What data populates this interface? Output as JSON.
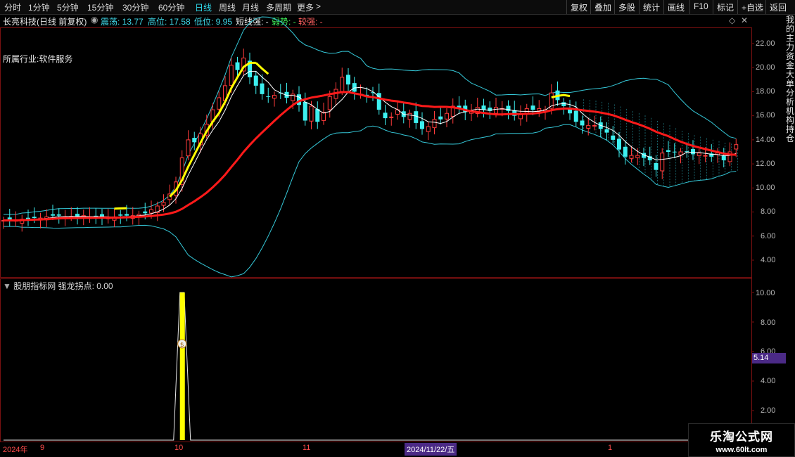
{
  "toolbar": {
    "periods": [
      "分时",
      "1分钟",
      "5分钟",
      "15分钟",
      "30分钟",
      "60分钟",
      "日线",
      "周线",
      "月线",
      "多周期",
      "更多"
    ],
    "active_period": "日线",
    "more_icon": "chevron-right-icon",
    "right_buttons": [
      "复权",
      "叠加",
      "多股",
      "统计",
      "画线",
      "F10",
      "标记",
      "+自选",
      "返回"
    ]
  },
  "infobar": {
    "stock": "长亮科技(日线 前复权)",
    "zhendang": "震荡: 13.77",
    "gaowei": "高位: 17.58",
    "diwei": "低位: 9.95",
    "duanxian": "短线强: -",
    "ruoshi": "弱势: -",
    "jiaoqiang": "较强: -"
  },
  "industry": "所属行业:软件服务",
  "main_axis": [
    "22.00",
    "20.00",
    "18.00",
    "16.00",
    "14.00",
    "12.00",
    "10.00",
    "8.00",
    "6.00",
    "4.00"
  ],
  "sub_panel": {
    "title": "股朋指标网 强龙拐点: 0.00",
    "axis": [
      "10.00",
      "8.00",
      "6.00",
      "4.00",
      "2.00"
    ],
    "price_tag": "5.14",
    "marker_glyph": "$"
  },
  "dates": {
    "labels": [
      "2024年",
      "9",
      "10",
      "11",
      "1"
    ],
    "highlight": "2024/11/22/五"
  },
  "right_strip_text": "我的主力资金大单分析机构持仓",
  "watermark": {
    "title": "乐淘公式网",
    "url": "www.60lt.com"
  },
  "colors": {
    "up": "#ff3b3b",
    "down": "#3df0f0",
    "yellow": "#ffff00",
    "red_line": "#ff1a1a",
    "band": "#35c8d8",
    "highlight": "#4b2a86"
  },
  "chart_data": {
    "type": "candlestick",
    "ylim": [
      3.0,
      23.5
    ],
    "closes": [
      7.3,
      7.3,
      7.3,
      7.4,
      7.4,
      7.5,
      7.5,
      7.6,
      7.7,
      7.7,
      7.6,
      7.6,
      7.6,
      7.7,
      7.6,
      7.6,
      7.6,
      7.5,
      7.6,
      7.7,
      7.7,
      7.7,
      7.8,
      7.9,
      8.2,
      8.5,
      8.8,
      9.5,
      10.5,
      12.5,
      14.0,
      13.8,
      14.5,
      15.3,
      16.5,
      17.5,
      18.5,
      20.2,
      19.8,
      20.8,
      19.2,
      18.5,
      17.8,
      17.6,
      17.7,
      17.9,
      17.5,
      17.8,
      16.9,
      15.6,
      16.8,
      15.5,
      16.3,
      17.6,
      18.2,
      19.2,
      18.6,
      18.0,
      17.8,
      17.7,
      17.9,
      16.5,
      15.8,
      15.9,
      16.5,
      15.9,
      16.2,
      15.4,
      14.9,
      15.1,
      15.7,
      15.7,
      16.2,
      16.8,
      16.6,
      16.3,
      16.4,
      16.7,
      16.5,
      16.4,
      16.7,
      16.6,
      16.4,
      16.0,
      16.2,
      16.6,
      16.5,
      16.6,
      16.5,
      17.9,
      17.3,
      16.8,
      16.2,
      15.5,
      15.2,
      15.2,
      15.2,
      14.9,
      14.6,
      14.0,
      13.2,
      12.6,
      12.7,
      12.7,
      12.5,
      12.3,
      11.5,
      12.9,
      13.0,
      13.0,
      13.0,
      13.0,
      12.8,
      12.9,
      12.7,
      12.6,
      12.9,
      12.3,
      13.0,
      13.6
    ],
    "yellow_line_segments": [
      [
        18,
        20
      ],
      [
        27,
        41
      ],
      [
        41,
        43
      ],
      [
        89,
        92
      ]
    ],
    "indicator_spike_index": 29,
    "indicator_spike_value": 10.0
  }
}
